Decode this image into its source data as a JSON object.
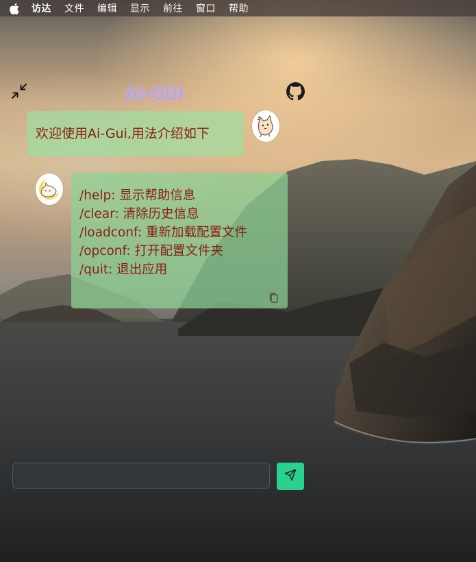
{
  "menubar": {
    "apple_icon": "apple-logo-icon",
    "items": [
      "访达",
      "文件",
      "编辑",
      "显示",
      "前往",
      "窗口",
      "帮助"
    ]
  },
  "header": {
    "title": "AI-GUI",
    "collapse_icon": "collapse-arrows-icon",
    "github_icon": "github-icon"
  },
  "chat": {
    "messages": [
      {
        "role": "user",
        "avatar_icon": "cartoon-cat-avatar-icon",
        "text": "欢迎使用Ai-Gui,用法介绍如下"
      },
      {
        "role": "assistant",
        "avatar_icon": "sleeping-cat-avatar-icon",
        "lines": [
          "/help: 显示帮助信息",
          "/clear: 清除历史信息",
          "/loadconf: 重新加载配置文件",
          "/opconf: 打开配置文件夹",
          "/quit: 退出应用"
        ],
        "copy_icon": "copy-icon"
      }
    ]
  },
  "composer": {
    "input_value": "",
    "input_placeholder": "",
    "send_icon": "send-paper-plane-icon",
    "send_color": "#2ad18f"
  },
  "colors": {
    "bubble_text": "#8a1f14",
    "bubble_bg": "#a0dea0"
  }
}
